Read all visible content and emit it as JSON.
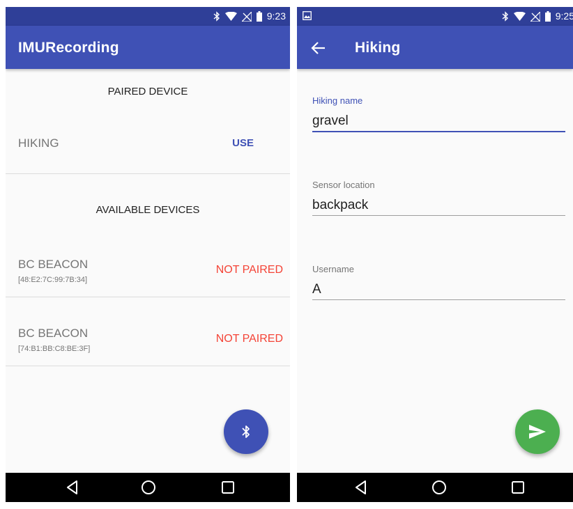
{
  "left_screen": {
    "status": {
      "time": "9:23"
    },
    "appbar": {
      "title": "IMURecording"
    },
    "paired_section": {
      "header": "PAIRED DEVICE",
      "device": {
        "name": "HIKING",
        "action": "USE"
      }
    },
    "available_section": {
      "header": "AVAILABLE DEVICES",
      "devices": [
        {
          "name": "BC BEACON",
          "mac": "[48:E2:7C:99:7B:34]",
          "status": "NOT PAIRED"
        },
        {
          "name": "BC BEACON",
          "mac": "[74:B1:BB:C8:BE:3F]",
          "status": "NOT PAIRED"
        }
      ]
    },
    "fab_icon": "bluetooth-icon"
  },
  "right_screen": {
    "status": {
      "time": "9:25"
    },
    "appbar": {
      "title": "Hiking",
      "nav_icon": "back-arrow-icon"
    },
    "form": {
      "hiking_name": {
        "label": "Hiking name",
        "value": "gravel"
      },
      "sensor_location": {
        "label": "Sensor location",
        "value": "backpack"
      },
      "username": {
        "label": "Username",
        "value": "A"
      }
    },
    "fab_icon": "send-icon"
  },
  "colors": {
    "primary": "#3f51b5",
    "primary_dark": "#2f3f98",
    "accent_green": "#4caf50",
    "error_red": "#f44336"
  }
}
